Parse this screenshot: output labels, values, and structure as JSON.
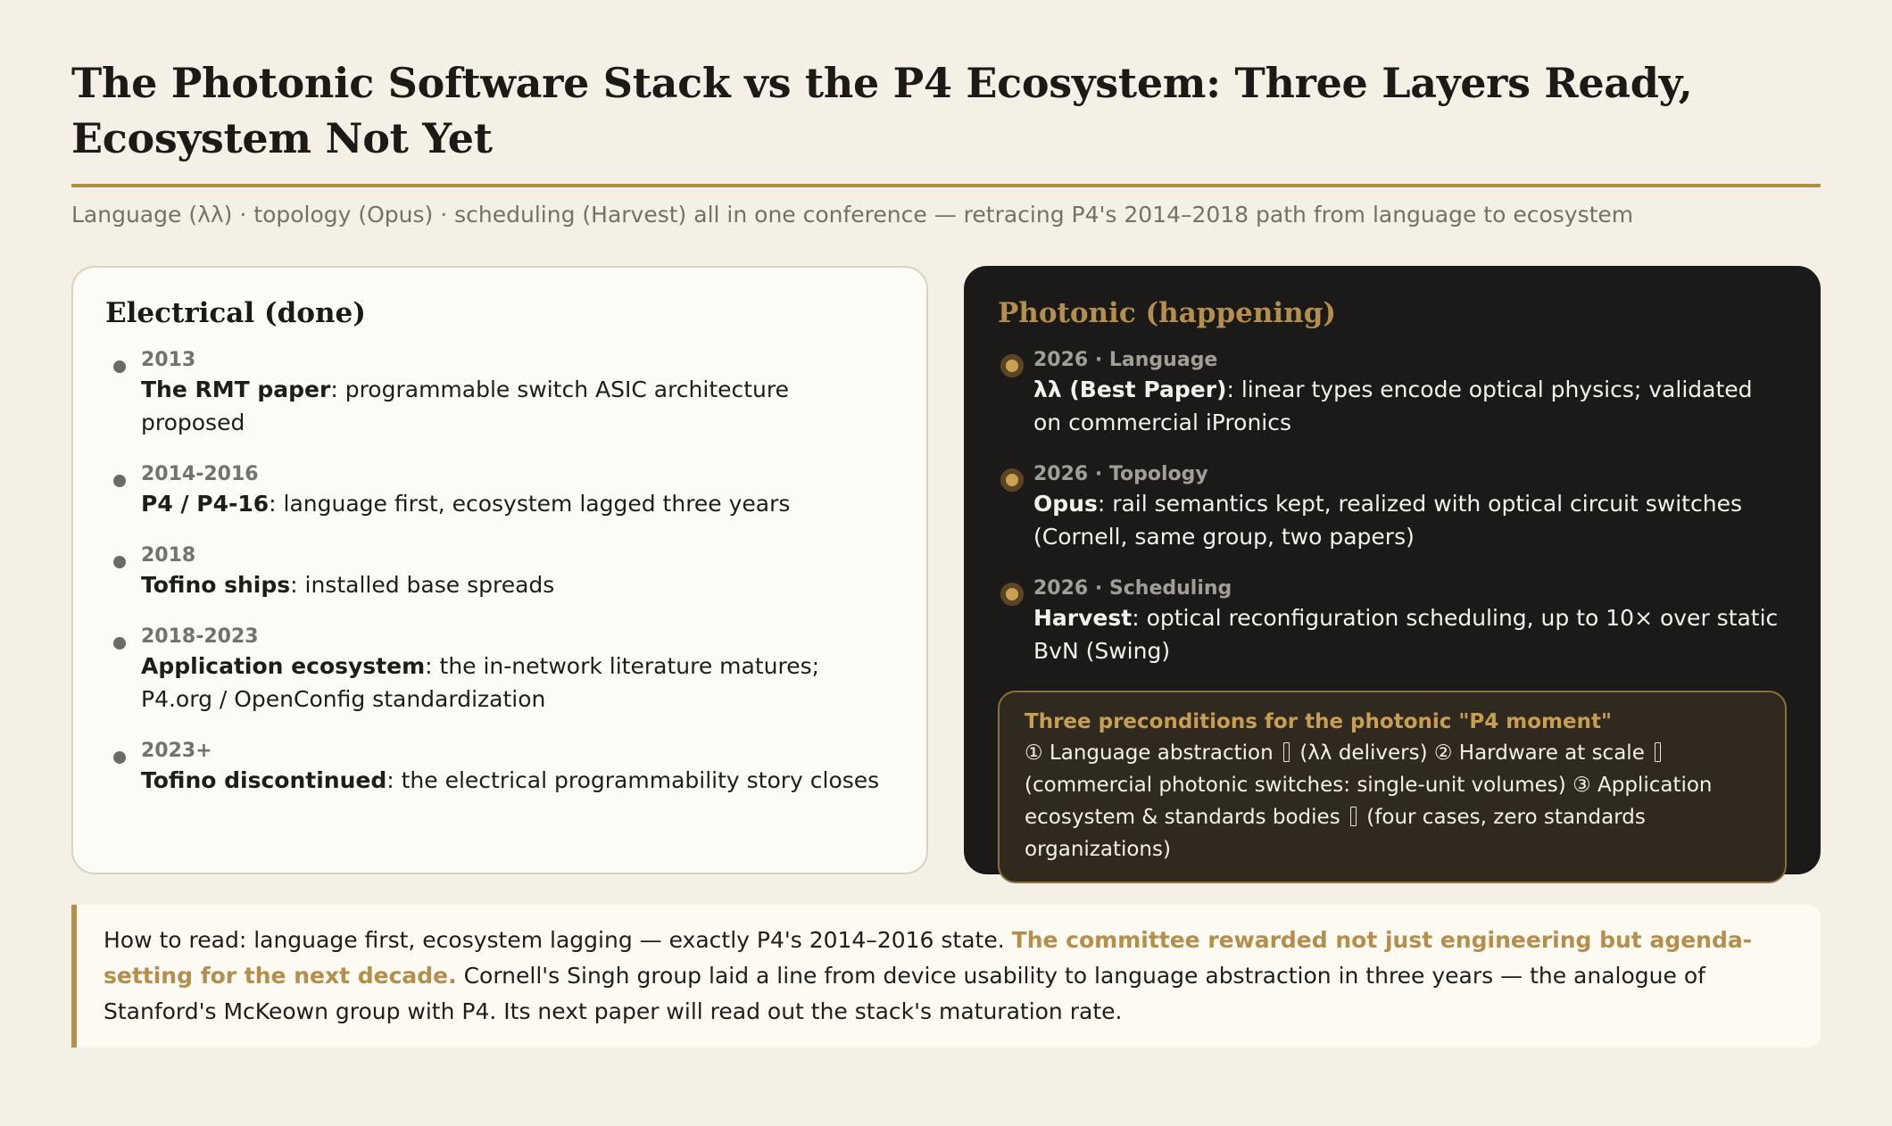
{
  "header": {
    "title_line1": "The Photonic Software Stack vs the P4 Ecosystem: Three Layers Ready,",
    "title_line2": "Ecosystem Not Yet",
    "subtitle": "Language (λλ) · topology (Opus) · scheduling (Harvest) all in one conference — retracing P4's 2014–2018 path from language to ecosystem"
  },
  "electrical": {
    "title": "Electrical (done)",
    "items": [
      {
        "year": "2013",
        "bold": "The RMT paper",
        "text": ": programmable switch ASIC architecture proposed"
      },
      {
        "year": "2014-2016",
        "bold": "P4 / P4-16",
        "text": ": language first, ecosystem lagged three years"
      },
      {
        "year": "2018",
        "bold": "Tofino ships",
        "text": ": installed base spreads"
      },
      {
        "year": "2018-2023",
        "bold": "Application ecosystem",
        "text": ": the in-network literature matures; P4.org / OpenConfig standardization"
      },
      {
        "year": "2023+",
        "bold": "Tofino discontinued",
        "text": ": the electrical programmability story closes"
      }
    ]
  },
  "photonic": {
    "title": "Photonic (happening)",
    "items": [
      {
        "year": "2026 · Language",
        "bold": "λλ (Best Paper)",
        "text": ": linear types encode optical physics; validated on commercial iPronics"
      },
      {
        "year": "2026 · Topology",
        "bold": "Opus",
        "text": ": rail semantics kept, realized with optical circuit switches (Cornell, same group, two papers)"
      },
      {
        "year": "2026 · Scheduling",
        "bold": "Harvest",
        "text": ": optical reconfiguration scheduling, up to 10× over static BvN (Swing)"
      }
    ],
    "preconditions": {
      "title": "Three preconditions for the photonic \"P4 moment\"",
      "p1_num": "①",
      "p1": " Language abstraction ",
      "p1_status": " (λλ delivers) ",
      "p2_num": "②",
      "p2": " Hardware at scale ",
      "p2_status": " (commercial photonic switches: single-unit volumes) ",
      "p3_num": "③",
      "p3": " Application ecosystem & standards bodies ",
      "p3_status": " (four cases, zero standards organizations)"
    }
  },
  "note": {
    "lead": "How to read: language first, ecosystem lagging — exactly P4's 2014–2016 state. ",
    "accent": "The committee rewarded not just engineering but agenda-setting for the next decade.",
    "tail": " Cornell's Singh group laid a line from device usability to language abstraction in three years — the analogue of Stanford's McKeown group with P4. Its next paper will read out the stack's maturation rate."
  }
}
